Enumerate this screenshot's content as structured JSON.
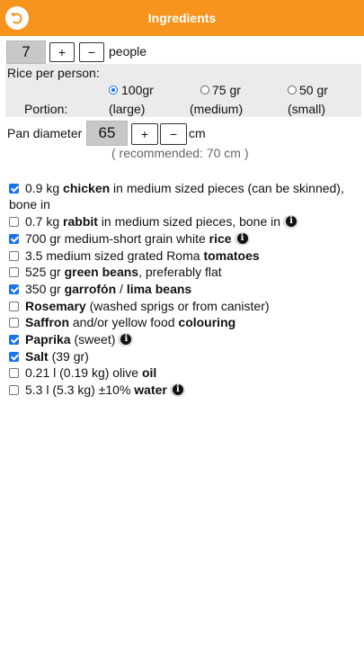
{
  "header": {
    "title": "Ingredients",
    "back_icon": "undo-arrow-icon"
  },
  "people": {
    "value": "7",
    "plus": "+",
    "minus": "−",
    "unit": "people"
  },
  "rice": {
    "label": "Rice per person:",
    "portion_label": "Portion:",
    "options": [
      {
        "amount": "100gr",
        "size": "(large)",
        "selected": true
      },
      {
        "amount": "75 gr",
        "size": "(medium)",
        "selected": false
      },
      {
        "amount": "50 gr",
        "size": "(small)",
        "selected": false
      }
    ]
  },
  "pan": {
    "label": "Pan diameter",
    "value": "65",
    "plus": "+",
    "minus": "−",
    "unit": "cm",
    "recommended": "( recommended:  70 cm )"
  },
  "ingredients": [
    {
      "checked": true,
      "pre": "0.9 kg ",
      "bold": "chicken",
      "post": " in medium sized pieces (can be skinned), bone in",
      "info": false
    },
    {
      "checked": false,
      "pre": "0.7 kg ",
      "bold": "rabbit",
      "post": " in medium sized pieces, bone in",
      "info": true
    },
    {
      "checked": true,
      "pre": "700 gr medium-short grain white ",
      "bold": "rice",
      "post": "",
      "info": true
    },
    {
      "checked": false,
      "pre": "3.5 medium sized grated Roma ",
      "bold": "tomatoes",
      "post": "",
      "info": false
    },
    {
      "checked": false,
      "pre": "525 gr ",
      "bold": "green beans",
      "post": ", preferably flat",
      "info": false
    },
    {
      "checked": true,
      "pre": "350 gr ",
      "bold": "garrofón",
      "mid": " / ",
      "bold2": "lima beans",
      "post": "",
      "info": false
    },
    {
      "checked": false,
      "pre": "",
      "bold": "Rosemary",
      "post": " (washed sprigs or from canister)",
      "info": false
    },
    {
      "checked": false,
      "pre": "",
      "bold": "Saffron",
      "mid": " and/or yellow food ",
      "bold2": "colouring",
      "post": "",
      "info": false
    },
    {
      "checked": true,
      "pre": "",
      "bold": "Paprika",
      "post": " (sweet)",
      "info": true
    },
    {
      "checked": true,
      "pre": "",
      "bold": "Salt",
      "post": " (39 gr)",
      "info": false
    },
    {
      "checked": false,
      "pre": "0.21 l (0.19 kg) olive ",
      "bold": "oil",
      "post": "",
      "info": false
    },
    {
      "checked": false,
      "pre": "5.3 l (5.3 kg) ±10% ",
      "bold": "water",
      "post": "",
      "info": true
    }
  ]
}
